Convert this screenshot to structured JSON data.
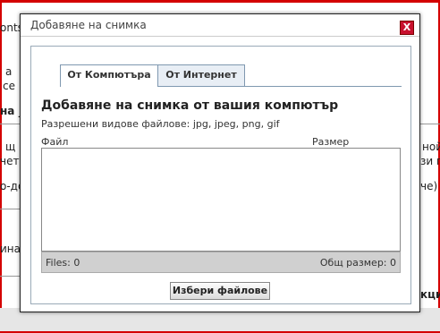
{
  "background": {
    "fragments": [
      "onts",
      "а",
      "се",
      "на _",
      "щ",
      "чет",
      "о-до",
      "ина",
      "ной ал",
      "зи п",
      "че)",
      "кци"
    ]
  },
  "dialog": {
    "title": "Добавяне на снимка",
    "close_label": "X",
    "tabs": [
      {
        "label": "От Компютъра",
        "active": true
      },
      {
        "label": "От Интернет",
        "active": false
      }
    ],
    "heading": "Добавяне на снимка от вашия компютър",
    "allowed_types": "Разрешени видове файлове: jpg, jpeg, png, gif",
    "columns": {
      "file": "Файл",
      "size": "Размер"
    },
    "footer": {
      "files": "Files: 0",
      "total": "Общ размер: 0"
    },
    "choose_button": "Избери файлове"
  }
}
